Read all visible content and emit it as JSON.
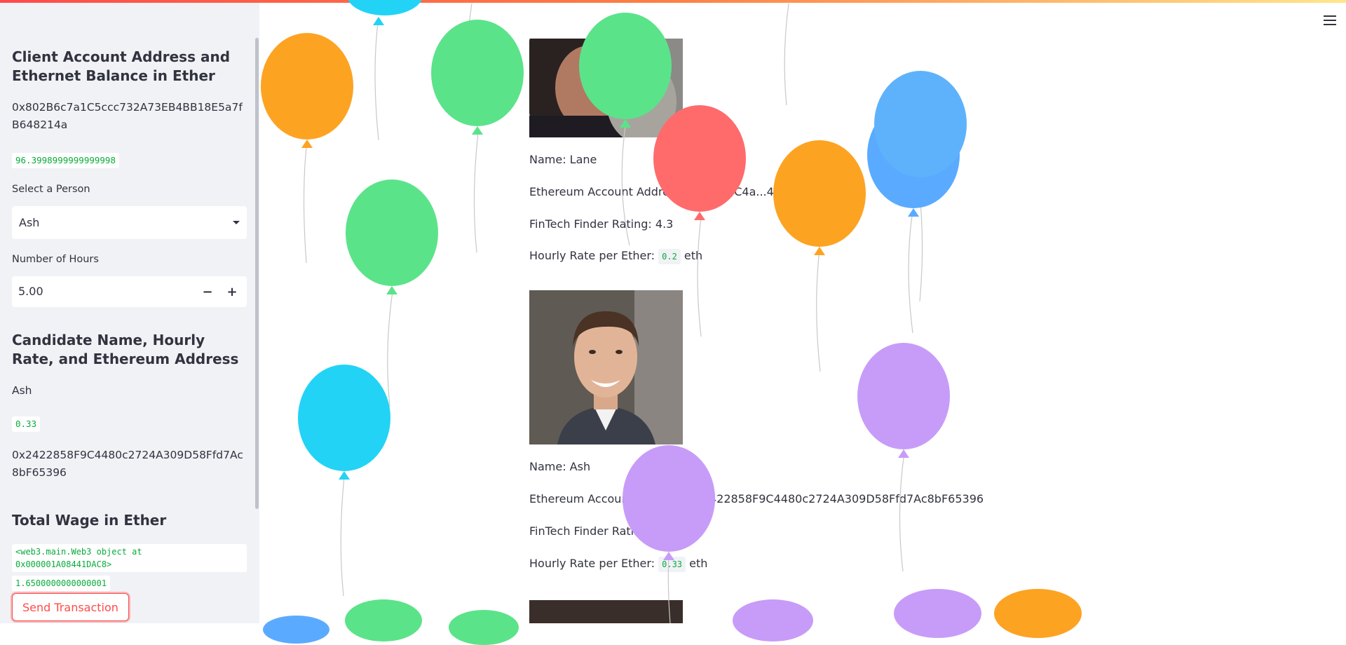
{
  "sidebar": {
    "client_title": "Client Account Address and Ethernet Balance in Ether",
    "client_address": "0x802B6c7a1C5ccc732A73EB4BB18E5a7fB648214a",
    "client_balance": "96.3998999999999998",
    "select_label": "Select a Person",
    "select_value": "Ash",
    "hours_label": "Number of Hours",
    "hours_value": "5.00",
    "candidate_title": "Candidate Name, Hourly Rate, and Ethereum Address",
    "candidate_name": "Ash",
    "candidate_rate": "0.33",
    "candidate_address": "0x2422858F9C4480c2724A309D58Ffd7Ac8bF65396",
    "wage_title": "Total Wage in Ether",
    "wage_object": "<web3.main.Web3 object at 0x000001A08441DAC8>",
    "wage_value": "1.6500000000000001",
    "send_button": "Send Transaction"
  },
  "cards": [
    {
      "name": "Name: Lane",
      "address": "Ethereum Account Address: 0x...ed5C4a...41...",
      "rating": "FinTech Finder Rating: 4.3",
      "rate_prefix": "Hourly Rate per Ether:",
      "rate": "0.2",
      "rate_suffix": "eth"
    },
    {
      "name": "Name: Ash",
      "address": "Ethereum Account Address: 0x2422858F9C4480c2724A309D58Ffd7Ac8bF65396",
      "rating": "FinTech Finder Rating",
      "rate_prefix": "Hourly Rate per Ether:",
      "rate": "0.33",
      "rate_suffix": "eth"
    }
  ],
  "icons": {
    "menu": "hamburger-menu-icon"
  },
  "colors": {
    "accent": "#ff4b4b",
    "code_green": "#09ab3b",
    "sidebar_bg": "#f0f2f6"
  }
}
